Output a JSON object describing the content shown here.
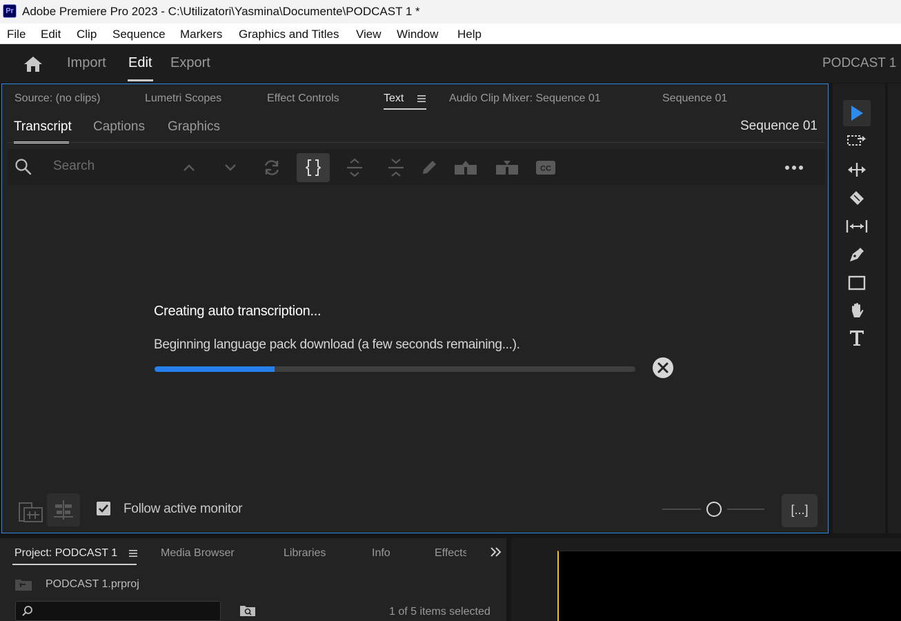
{
  "window": {
    "logo": "Pr",
    "title": "Adobe Premiere Pro 2023 - C:\\Utilizatori\\Yasmina\\Documente\\PODCAST 1 *"
  },
  "menu": [
    "File",
    "Edit",
    "Clip",
    "Sequence",
    "Markers",
    "Graphics and Titles",
    "View",
    "Window",
    "Help"
  ],
  "workspace": {
    "tabs": [
      "Import",
      "Edit",
      "Export"
    ],
    "active_tab": "Edit",
    "project_name": "PODCAST 1"
  },
  "panel_tabs": [
    "Source: (no clips)",
    "Lumetri Scopes",
    "Effect Controls",
    "Text",
    "Audio Clip Mixer: Sequence 01",
    "Sequence 01"
  ],
  "active_panel_tab": "Text",
  "text_panel": {
    "sub_tabs": [
      "Transcript",
      "Captions",
      "Graphics"
    ],
    "active_sub_tab": "Transcript",
    "sequence_label": "Sequence 01",
    "search_placeholder": "Search",
    "status_title": "Creating auto transcription...",
    "status_message": "Beginning language pack download (a few seconds remaining...).",
    "progress": 0.25,
    "follow_label": "Follow active monitor",
    "follow_checked": true,
    "caption_button": "[...]"
  },
  "right_tools": [
    "selection-tool",
    "track-select-tool",
    "ripple-edit-tool",
    "razor-tool",
    "slip-tool",
    "pen-tool",
    "rectangle-tool",
    "hand-tool",
    "type-tool"
  ],
  "project_panel": {
    "tabs": [
      "Project: PODCAST 1",
      "Media Browser",
      "Libraries",
      "Info",
      "Effects"
    ],
    "active_tab": "Project: PODCAST 1",
    "file": "PODCAST 1.prproj",
    "selection_status": "1 of 5 items selected"
  },
  "colors": {
    "accent": "#2680eb",
    "panel_border": "#2d8ceb",
    "panel_bg": "#232323",
    "playhead": "#e6c619"
  }
}
